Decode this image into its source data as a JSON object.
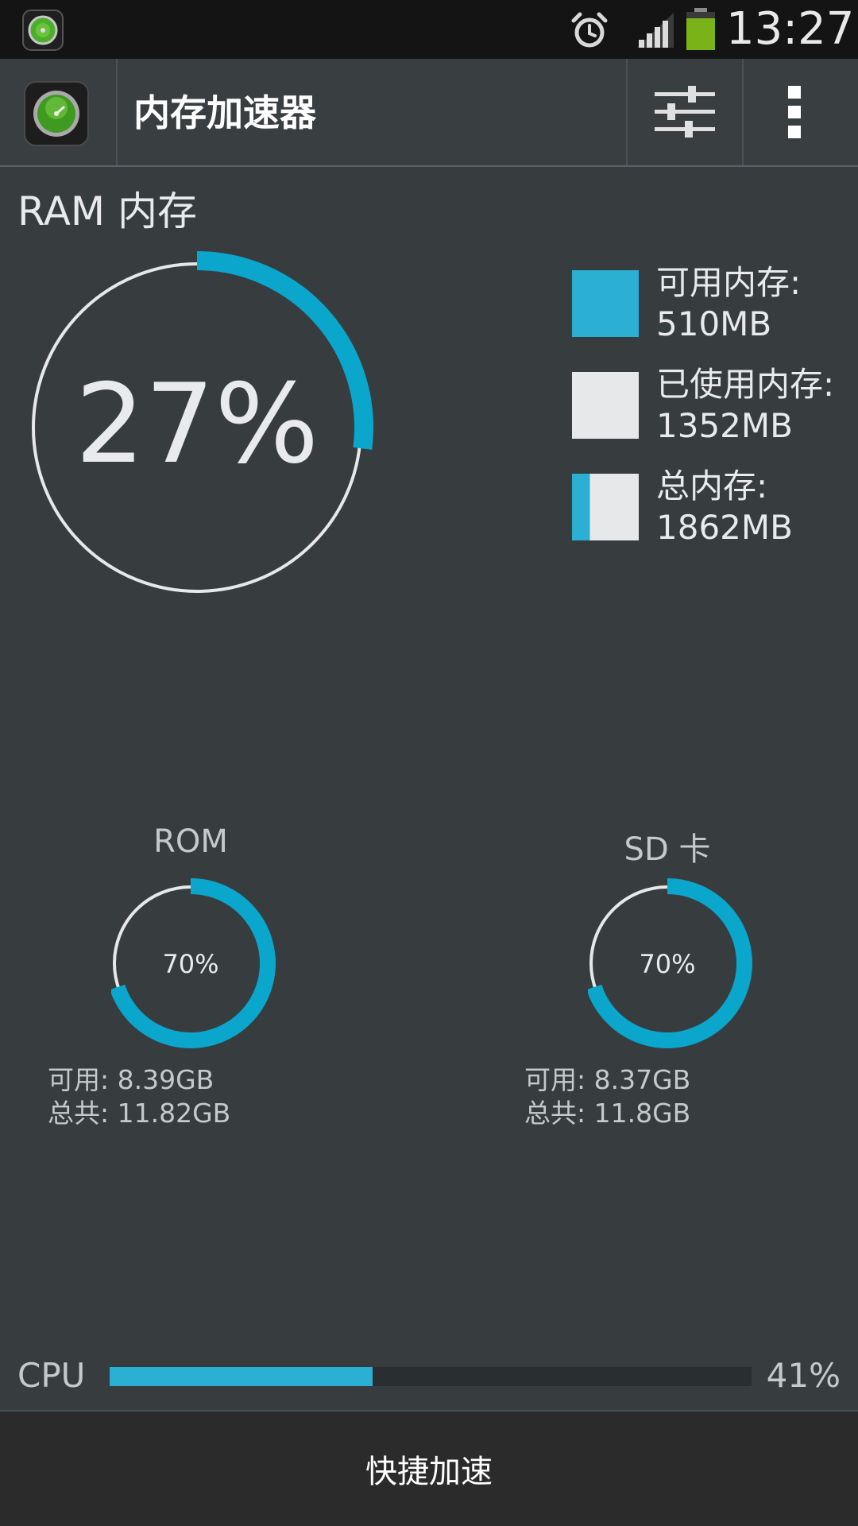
{
  "status_bar": {
    "time": "13:27",
    "icons": [
      "app-icon",
      "alarm-icon",
      "signal-icon",
      "battery-icon"
    ],
    "battery_color": "#7ab317"
  },
  "action_bar": {
    "title": "内存加速器",
    "icons": [
      "app-icon",
      "sliders-icon",
      "overflow-menu-icon"
    ]
  },
  "ram": {
    "title": "RAM 内存",
    "percent_text": "27%",
    "used_fraction": 0.27,
    "legend": [
      {
        "label": "可用内存:",
        "value": "510MB",
        "type": "available"
      },
      {
        "label": "已使用内存:",
        "value": "1352MB",
        "type": "used"
      },
      {
        "label": "总内存:",
        "value": "1862MB",
        "type": "total"
      }
    ]
  },
  "rom": {
    "title": "ROM",
    "percent_text": "70%",
    "fraction": 0.7,
    "available": "可用: 8.39GB",
    "total": "总共: 11.82GB"
  },
  "sd": {
    "title": "SD 卡",
    "percent_text": "70%",
    "fraction": 0.7,
    "available": "可用: 8.37GB",
    "total": "总共: 11.8GB"
  },
  "cpu": {
    "label": "CPU",
    "percent_text": "41%",
    "fraction": 0.41
  },
  "boost_button": {
    "label": "快捷加速"
  },
  "colors": {
    "accent": "#0aa6cc",
    "legend_blue": "#2bb0d4",
    "ring_gray": "#e6e8e9",
    "background": "#373c3e"
  }
}
